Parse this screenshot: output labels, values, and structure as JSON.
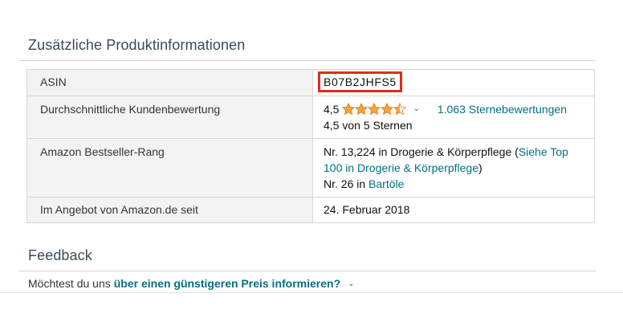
{
  "section_title": "Zusätzliche Produktinformationen",
  "rows": {
    "asin": {
      "label": "ASIN",
      "value": "B07B2JHFS5"
    },
    "rating": {
      "label": "Durchschnittliche Kundenbewertung",
      "score": "4,5",
      "stars_value": 4.5,
      "stars_max": 5,
      "ratings_link": "1.063 Sternebewertungen",
      "subtext": "4,5 von 5 Sternen"
    },
    "rank": {
      "label": "Amazon Bestseller-Rang",
      "prefix": "Nr. 13,224 in Drogerie & Körperpflege (",
      "top_link": "Siehe Top 100 in Drogerie & Körperpflege",
      "suffix": ")",
      "sub_prefix": "Nr. 26 in ",
      "sub_link": "Bartöle"
    },
    "since": {
      "label": "Im Angebot von Amazon.de seit",
      "value": "24. Februar 2018"
    }
  },
  "feedback": {
    "title": "Feedback",
    "text": "Möchtest du uns",
    "link": "über einen günstigeren Preis informieren?"
  },
  "colors": {
    "link": "#007185",
    "star": "#f7a43a",
    "highlight": "#e32b1b"
  },
  "icons": {
    "star": "star-icon",
    "chevron": "chevron-down-icon"
  }
}
